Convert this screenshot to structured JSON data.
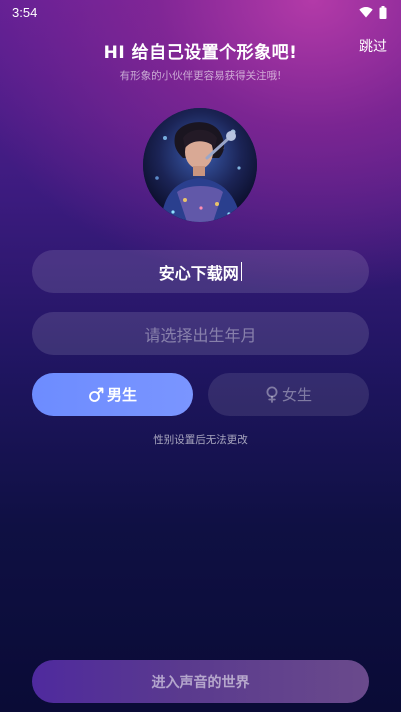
{
  "status_bar": {
    "time": "3:54",
    "icons": [
      "wifi-icon",
      "battery-icon"
    ]
  },
  "header": {
    "skip_label": "跳过",
    "title": "HI 给自己设置个形象吧!",
    "subtitle": "有形象的小伙伴更容易获得关注哦!"
  },
  "avatar": {
    "description_icon": "avatar-image"
  },
  "form": {
    "nickname_value": "安心下载网",
    "birth_placeholder": "请选择出生年月",
    "male_label": "男生",
    "female_label": "女生",
    "male_icon": "male-symbol-icon",
    "female_icon": "female-symbol-icon",
    "selected_gender": "male",
    "gender_hint": "性别设置后无法更改"
  },
  "footer": {
    "enter_label": "进入声音的世界"
  },
  "colors": {
    "male_button": "#7a95ff",
    "background_top": "#5e1f95",
    "background_bottom": "#0a0b36"
  }
}
